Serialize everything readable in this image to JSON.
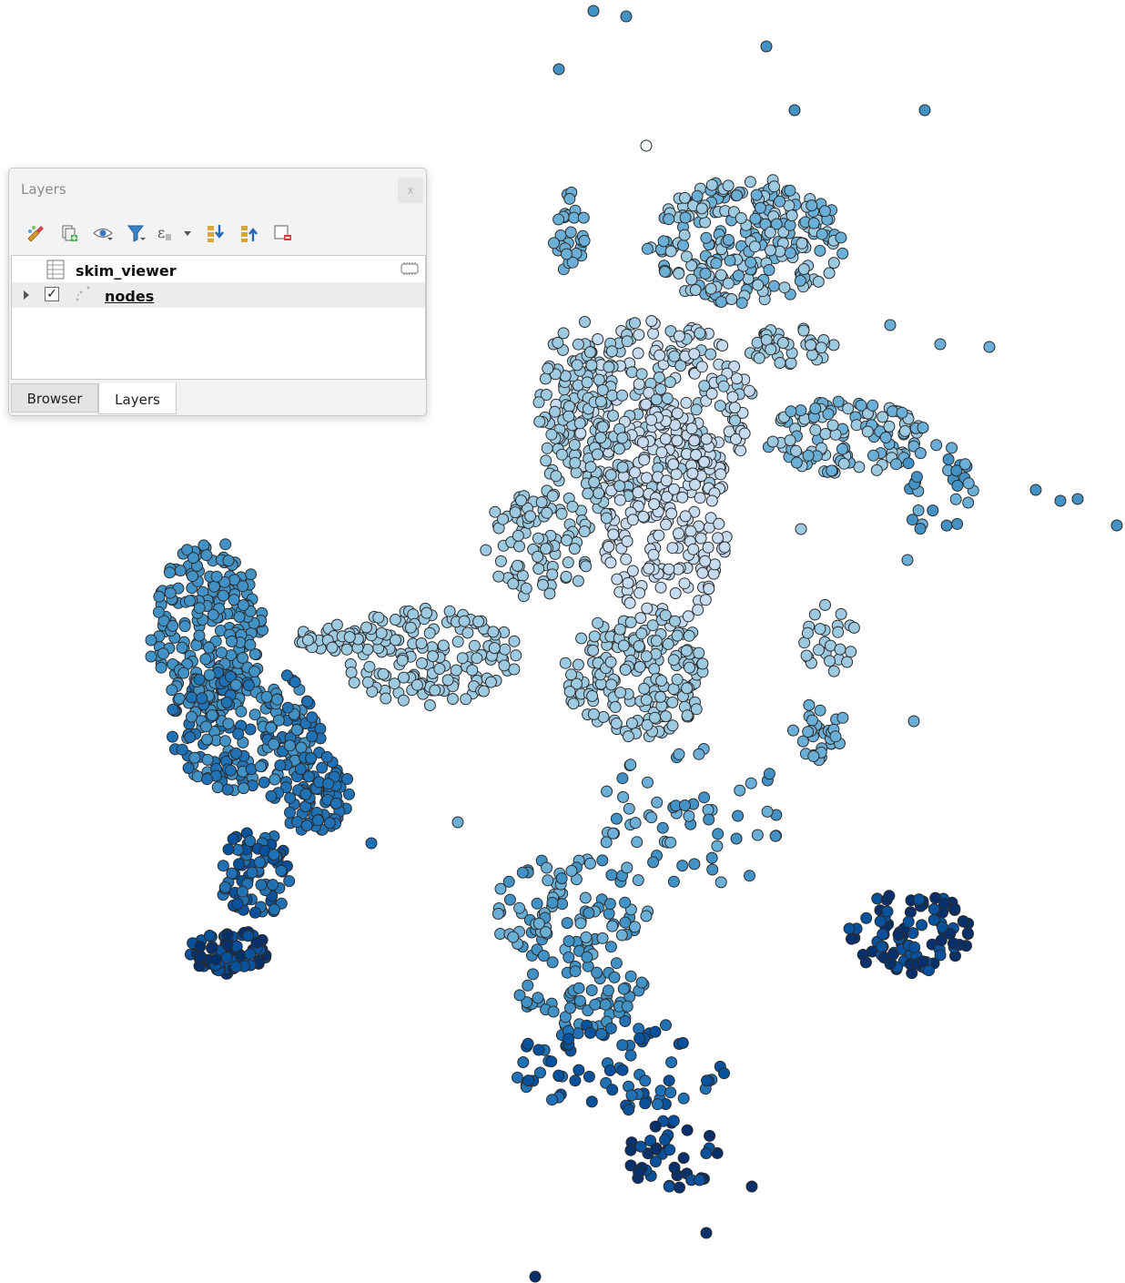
{
  "map": {
    "layer_name": "nodes",
    "stroke_color": "#2b2b2b",
    "color_ramp": [
      "#f7fbff",
      "#c6dbef",
      "#9ecae1",
      "#6baed6",
      "#4292c6",
      "#2171b5",
      "#08519c",
      "#08306b"
    ],
    "color_ramp_name": "Blues"
  },
  "layers_panel": {
    "title": "Layers",
    "close_label": "x",
    "toolbar": [
      {
        "name": "style-manager-icon"
      },
      {
        "name": "add-group-icon"
      },
      {
        "name": "visibility-icon"
      },
      {
        "name": "filter-legend-icon"
      },
      {
        "name": "filter-expression-icon"
      },
      {
        "name": "expand-all-icon"
      },
      {
        "name": "collapse-all-icon"
      },
      {
        "name": "remove-layer-icon"
      }
    ],
    "layers": [
      {
        "name": "skim_viewer",
        "type": "table-icon",
        "has_checkbox": false,
        "indicator": "embedded-layer-icon"
      },
      {
        "name": "nodes",
        "type": "point-layer-icon",
        "has_checkbox": true,
        "checked": true,
        "checkmark": "✓",
        "selected": true
      }
    ],
    "tabs": [
      {
        "label": "Browser",
        "active": false
      },
      {
        "label": "Layers",
        "active": true
      }
    ]
  }
}
